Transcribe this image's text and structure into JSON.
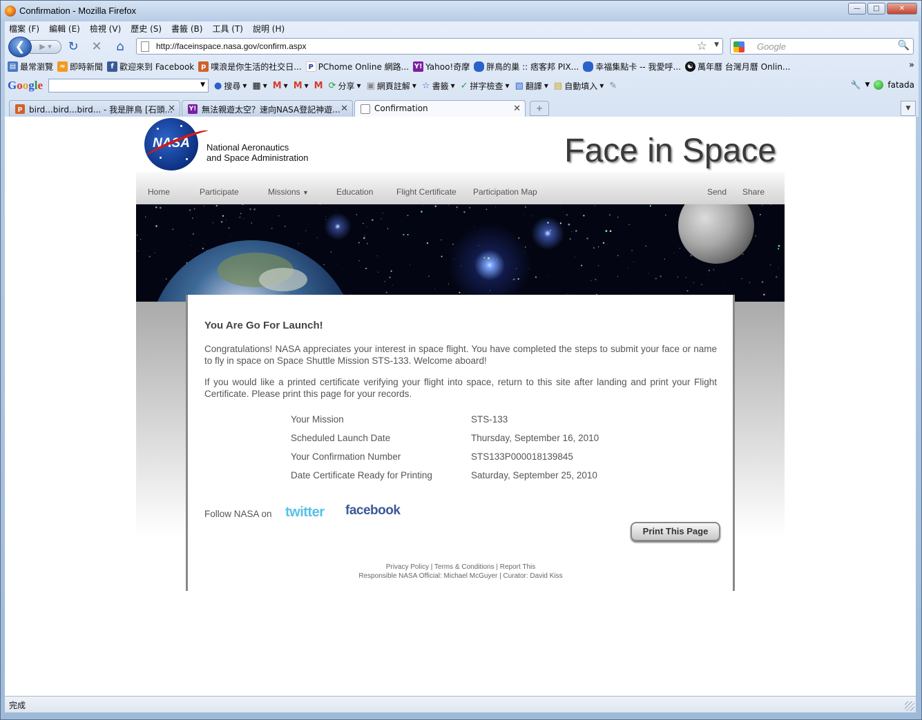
{
  "window": {
    "title": "Confirmation - Mozilla Firefox"
  },
  "menu": [
    "檔案 (F)",
    "編輯 (E)",
    "檢視 (V)",
    "歷史 (S)",
    "書籤 (B)",
    "工具 (T)",
    "說明 (H)"
  ],
  "address": {
    "url": "http://faceinspace.nasa.gov/confirm.aspx"
  },
  "search": {
    "placeholder": "Google"
  },
  "bookmarks": [
    "最常瀏覽",
    "即時新聞",
    "歡迎來到 Facebook",
    "噗浪是你生活的社交日...",
    "PChome Online 網路...",
    "Yahoo!奇摩",
    "胖鳥的巢 :: 痞客邦 PIX...",
    "幸福集點卡 -- 我愛呼...",
    "萬年曆 台灣月曆 Onlin..."
  ],
  "google_toolbar": {
    "logo": "Google",
    "search": "搜尋",
    "share": "分享",
    "annotate": "網頁註解",
    "bookmarks": "書籤",
    "spellcheck": "拼字檢查",
    "translate": "翻譯",
    "autofill": "自動填入",
    "user": "fatada"
  },
  "tabs": [
    {
      "label": "bird...bird...bird... - 我是胖鳥 [石頭...",
      "active": false
    },
    {
      "label": "無法親遊太空？速向NASA登記神遊...",
      "active": false
    },
    {
      "label": "Confirmation",
      "active": true
    }
  ],
  "site": {
    "agency_line1": "National Aeronautics",
    "agency_line2": "and Space Administration",
    "logo_text": "NASA",
    "title": "Face in Space",
    "nav": [
      "Home",
      "Participate",
      "Missions",
      "Education",
      "Flight Certificate",
      "Participation Map"
    ],
    "nav_right": [
      "Send",
      "Share"
    ]
  },
  "confirmation": {
    "heading": "You Are Go For Launch!",
    "para1": "Congratulations! NASA appreciates your interest in space flight. You have completed the steps to submit your face or name to fly in space on Space Shuttle Mission STS-133. Welcome aboard!",
    "para2": "If you would like a printed certificate verifying your flight into space, return to this site after landing and print your Flight Certificate. Please print this page for your records.",
    "details": [
      {
        "label": "Your Mission",
        "value": "STS-133"
      },
      {
        "label": "Scheduled Launch Date",
        "value": "Thursday, September 16, 2010"
      },
      {
        "label": "Your Confirmation Number",
        "value": "STS133P000018139845"
      },
      {
        "label": "Date Certificate Ready for Printing",
        "value": "Saturday, September 25, 2010"
      }
    ],
    "follow": "Follow NASA on",
    "twitter": "twitter",
    "facebook": "facebook",
    "print_button": "Print This Page",
    "footer1": "Privacy Policy | Terms & Conditions | Report This",
    "footer2": "Responsible NASA Official: Michael McGuyer | Curator: David Kiss"
  },
  "status": {
    "text": "完成"
  }
}
